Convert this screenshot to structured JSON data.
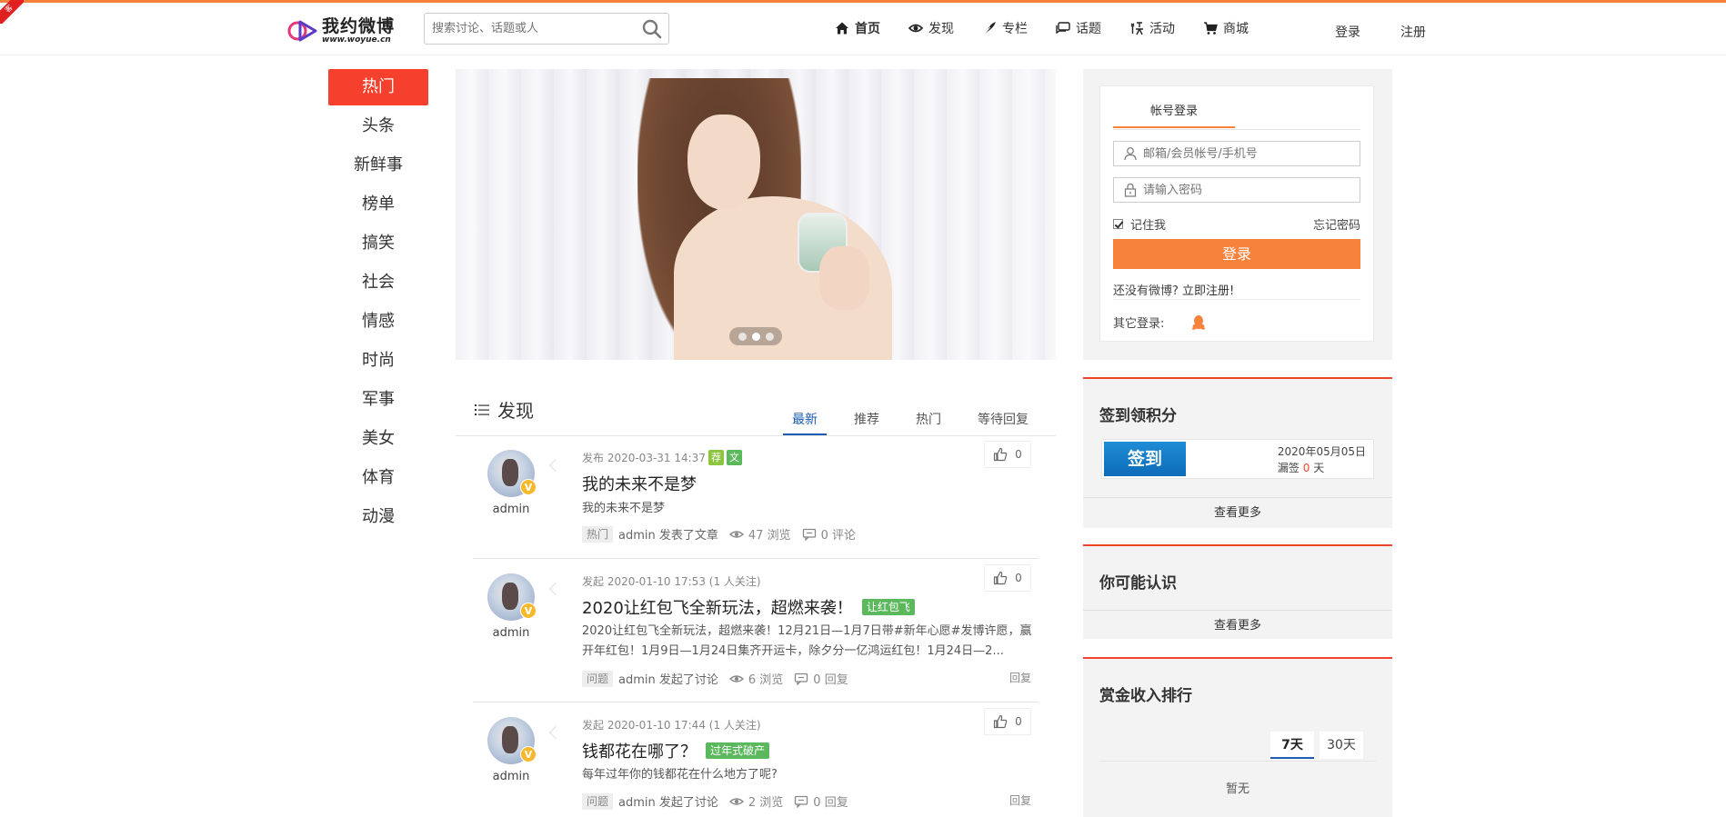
{
  "corner": {
    "label": "客"
  },
  "logo": {
    "cn": "我约微博",
    "en": "www.woyue.cn"
  },
  "search": {
    "placeholder": "搜索讨论、话题或人"
  },
  "nav": {
    "items": [
      {
        "label": "首页",
        "icon": "home-icon"
      },
      {
        "label": "发现",
        "icon": "eye-icon"
      },
      {
        "label": "专栏",
        "icon": "feather-icon"
      },
      {
        "label": "话题",
        "icon": "chat-icon"
      },
      {
        "label": "活动",
        "icon": "activity-icon"
      },
      {
        "label": "商城",
        "icon": "cart-icon"
      }
    ],
    "login": "登录",
    "register": "注册"
  },
  "categories": [
    "热门",
    "头条",
    "新鲜事",
    "榜单",
    "搞笑",
    "社会",
    "情感",
    "时尚",
    "军事",
    "美女",
    "体育",
    "动漫"
  ],
  "banner": {
    "active_dot": 1,
    "dot_count": 3
  },
  "discover": {
    "title": "发现",
    "tabs": [
      "最新",
      "推荐",
      "热门",
      "等待回复"
    ]
  },
  "posts": [
    {
      "author": "admin",
      "meta": "发布 2020-03-31 14:37",
      "badges": [
        {
          "text": "荐",
          "color": "#8cc63f"
        },
        {
          "text": "文",
          "color": "#5cb85c"
        }
      ],
      "title": "我的未来不是梦",
      "tag": "",
      "excerpt": "我的未来不是梦",
      "chip": "热门",
      "action": "admin 发表了文章",
      "views": "47 浏览",
      "comments": "0 评论",
      "likes": "0",
      "reply": ""
    },
    {
      "author": "admin",
      "meta": "发起 2020-01-10 17:53 (1 人关注)",
      "badges": [],
      "title": "2020让红包飞全新玩法，超燃来袭！",
      "tag": "让红包飞",
      "excerpt": "2020让红包飞全新玩法，超燃来袭！12月21日—1月7日带#新年心愿#发博许愿，赢开年红包！1月9日—1月24日集齐开运卡，除夕分一亿鸿运红包！1月24日—2...",
      "chip": "问题",
      "action": "admin 发起了讨论",
      "views": "6 浏览",
      "comments": "0 回复",
      "likes": "0",
      "reply": "回复"
    },
    {
      "author": "admin",
      "meta": "发起 2020-01-10 17:44 (1 人关注)",
      "badges": [],
      "title": "钱都花在哪了？",
      "tag": "过年式破产",
      "excerpt": "每年过年你的钱都花在什么地方了呢?",
      "chip": "问题",
      "action": "admin 发起了讨论",
      "views": "2 浏览",
      "comments": "0 回复",
      "likes": "0",
      "reply": "回复"
    }
  ],
  "login_card": {
    "tab": "帐号登录",
    "user_placeholder": "邮箱/会员帐号/手机号",
    "pass_placeholder": "请输入密码",
    "remember": "记住我",
    "forgot": "忘记密码",
    "submit": "登录",
    "no_account": "还没有微博?",
    "register_now": "立即注册!",
    "other_login": "其它登录:"
  },
  "signin": {
    "title": "签到领积分",
    "button": "签到",
    "date": "2020年05月05日",
    "missed_prefix": "漏签",
    "missed_count": "0",
    "missed_suffix": "天",
    "more": "查看更多"
  },
  "people": {
    "title": "你可能认识",
    "more": "查看更多"
  },
  "ranking": {
    "title": "赏金收入排行",
    "tabs": [
      "7天",
      "30天"
    ],
    "empty": "暂无"
  },
  "colors": {
    "accent": "#f7823c",
    "hot": "#f5402d",
    "blue": "#1a5db3"
  }
}
